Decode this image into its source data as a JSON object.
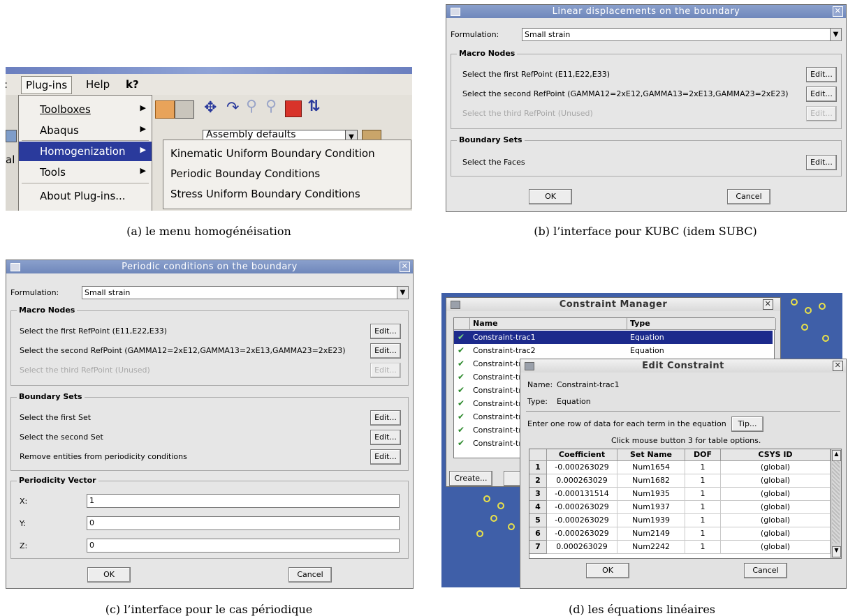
{
  "captions": {
    "a": "(a) le menu homogénéisation",
    "b": "(b) l’interface pour KUBC (idem SUBC)",
    "c": "(c) l’interface pour le cas périodique",
    "d": "(d) les équations linéaires"
  },
  "menu_panel": {
    "menubar": {
      "plugins": "Plug-ins",
      "help": "Help",
      "whatsthis": "k?"
    },
    "plugins_menu": [
      "Toolboxes",
      "Abaqus",
      "Homogenization",
      "Tools",
      "About Plug-ins..."
    ],
    "selected": "Homogenization",
    "submenu": [
      "Kinematic Uniform Boundary Condition",
      "Periodic Bounday Conditions",
      "Stress Uniform Boundary Conditions"
    ],
    "left_edge": "al",
    "combo_text": "Assembly defaults"
  },
  "kubc_dialog": {
    "title": "Linear displacements on the boundary",
    "formulation_label": "Formulation:",
    "formulation_value": "Small strain",
    "macro_nodes": "Macro Nodes",
    "rows": [
      "Select the first RefPoint (E11,E22,E33)",
      "Select the second RefPoint (GAMMA12=2xE12,GAMMA13=2xE13,GAMMA23=2xE23)",
      "Select the third RefPoint (Unused)"
    ],
    "boundary_sets": "Boundary Sets",
    "faces": "Select the Faces",
    "edit": "Edit...",
    "ok": "OK",
    "cancel": "Cancel"
  },
  "periodic_dialog": {
    "title": "Periodic conditions on the boundary",
    "formulation_label": "Formulation:",
    "formulation_value": "Small strain",
    "macro_nodes": "Macro Nodes",
    "rows": [
      "Select the first RefPoint (E11,E22,E33)",
      "Select the second RefPoint (GAMMA12=2xE12,GAMMA13=2xE13,GAMMA23=2xE23)",
      "Select the third RefPoint (Unused)"
    ],
    "boundary_sets": "Boundary Sets",
    "set_rows": [
      "Select the first Set",
      "Select the second Set",
      "Remove entities from periodicity conditions"
    ],
    "periodicity": "Periodicity Vector",
    "vector": [
      {
        "label": "X:",
        "value": "1"
      },
      {
        "label": "Y:",
        "value": "0"
      },
      {
        "label": "Z:",
        "value": "0"
      }
    ],
    "edit": "Edit...",
    "ok": "OK",
    "cancel": "Cancel"
  },
  "constraint_manager": {
    "title": "Constraint Manager",
    "headers": [
      "Name",
      "Type"
    ],
    "rows": [
      {
        "name": "Constraint-trac1",
        "type": "Equation"
      },
      {
        "name": "Constraint-trac2",
        "type": "Equation"
      },
      {
        "name": "Constraint-tra",
        "type": ""
      },
      {
        "name": "Constraint-tra",
        "type": ""
      },
      {
        "name": "Constraint-tra",
        "type": ""
      },
      {
        "name": "Constraint-tra",
        "type": ""
      },
      {
        "name": "Constraint-tra",
        "type": ""
      },
      {
        "name": "Constraint-tra",
        "type": ""
      },
      {
        "name": "Constraint-tra",
        "type": ""
      }
    ],
    "create": "Create..."
  },
  "edit_constraint": {
    "title": "Edit Constraint",
    "name_label": "Name:",
    "name_value": "Constraint-trac1",
    "type_label": "Type:",
    "type_value": "Equation",
    "instruction": "Enter one row of data for each term in the equation",
    "tip": "Tip...",
    "hint": "Click mouse button 3 for table options.",
    "headers": [
      "Coefficient",
      "Set Name",
      "DOF",
      "CSYS ID"
    ],
    "rows": [
      {
        "n": "1",
        "coef": "-0.000263029",
        "set": "Num1654",
        "dof": "1",
        "csys": "(global)"
      },
      {
        "n": "2",
        "coef": "0.000263029",
        "set": "Num1682",
        "dof": "1",
        "csys": "(global)"
      },
      {
        "n": "3",
        "coef": "-0.000131514",
        "set": "Num1935",
        "dof": "1",
        "csys": "(global)"
      },
      {
        "n": "4",
        "coef": "-0.000263029",
        "set": "Num1937",
        "dof": "1",
        "csys": "(global)"
      },
      {
        "n": "5",
        "coef": "-0.000263029",
        "set": "Num1939",
        "dof": "1",
        "csys": "(global)"
      },
      {
        "n": "6",
        "coef": "-0.000263029",
        "set": "Num2149",
        "dof": "1",
        "csys": "(global)"
      },
      {
        "n": "7",
        "coef": "0.000263029",
        "set": "Num2242",
        "dof": "1",
        "csys": "(global)"
      }
    ],
    "ok": "OK",
    "cancel": "Cancel"
  }
}
